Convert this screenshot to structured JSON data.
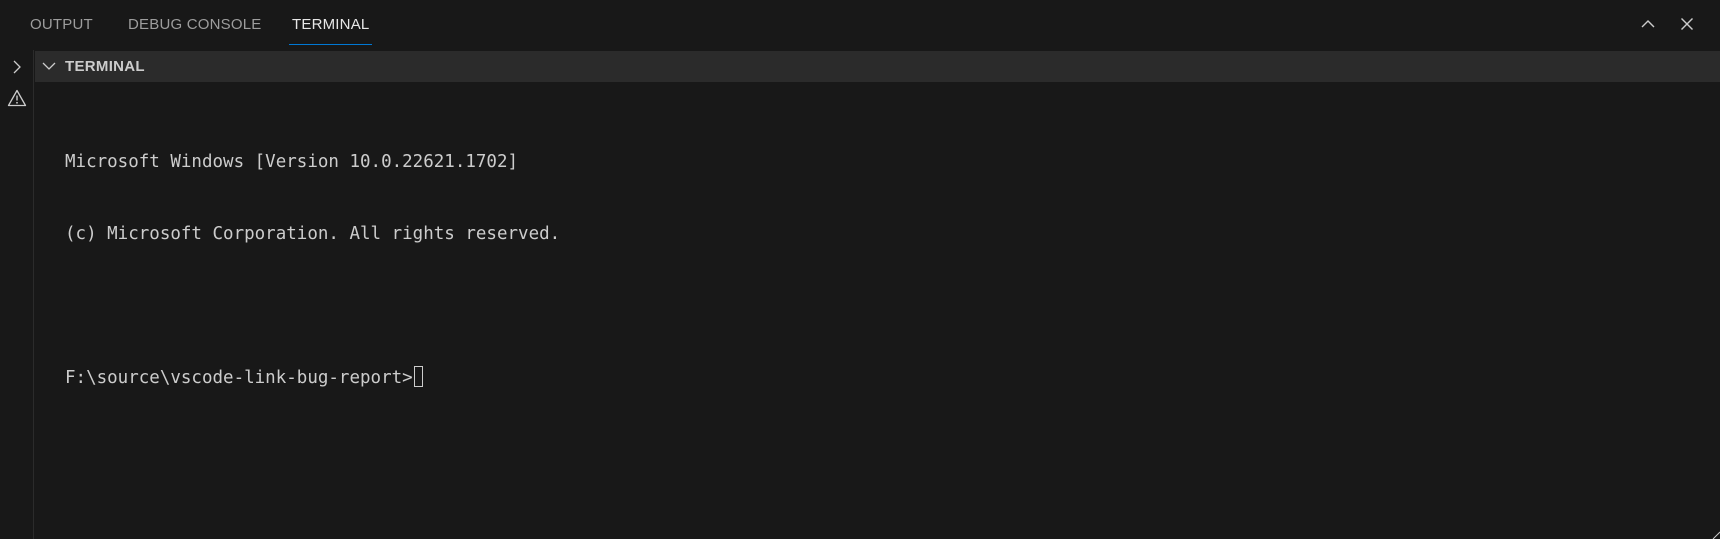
{
  "tabs": [
    {
      "label": "OUTPUT",
      "active": false
    },
    {
      "label": "DEBUG CONSOLE",
      "active": false
    },
    {
      "label": "TERMINAL",
      "active": true
    }
  ],
  "actions": {
    "maximize_icon": "chevron-up-icon",
    "close_icon": "close-icon"
  },
  "left_strip": {
    "icons": [
      "chevron-right-icon",
      "warning-icon"
    ]
  },
  "section": {
    "title": "TERMINAL",
    "expanded": true
  },
  "terminal": {
    "lines": [
      "Microsoft Windows [Version 10.0.22621.1702]",
      "(c) Microsoft Corporation. All rights reserved.",
      "",
      "F:\\source\\vscode-link-bug-report>"
    ]
  },
  "colors": {
    "background": "#181818",
    "section_header": "#2b2b2b",
    "text": "#cccccc",
    "active_tab_underline": "#0078d4",
    "inactive_tab": "#9d9d9d"
  }
}
